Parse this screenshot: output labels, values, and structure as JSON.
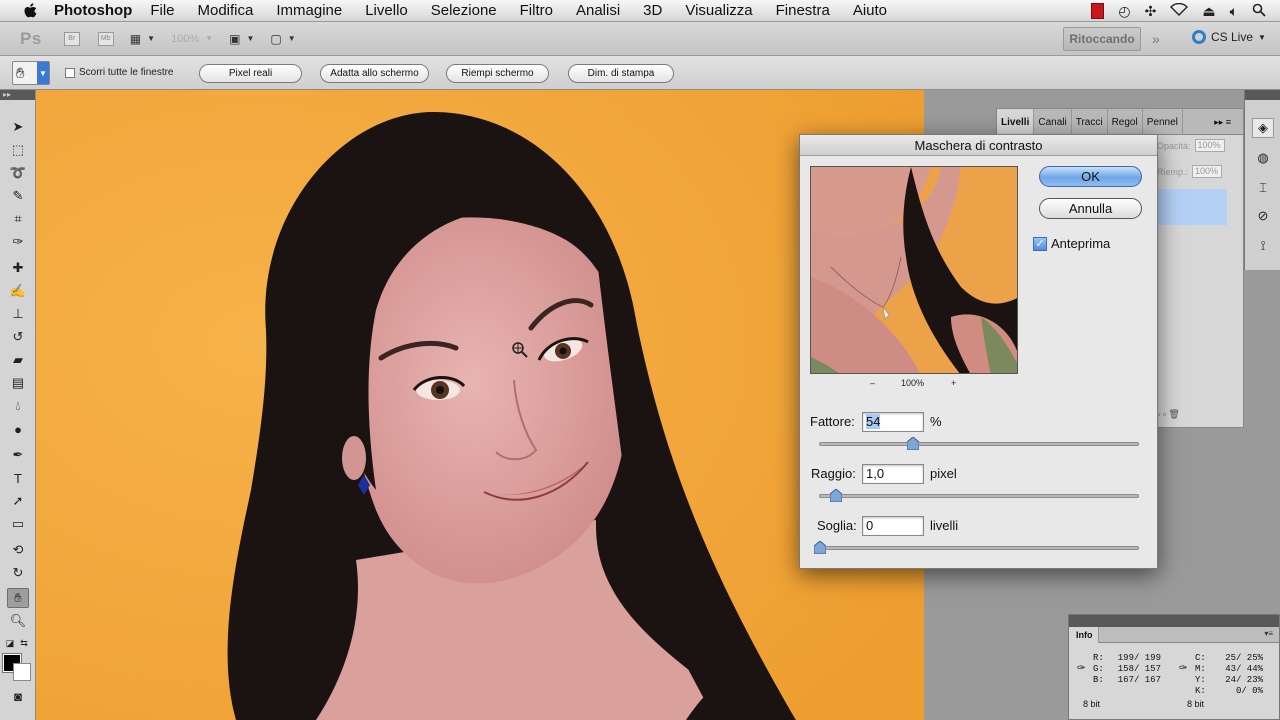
{
  "menubar": {
    "app_name": "Photoshop",
    "items": [
      "File",
      "Modifica",
      "Immagine",
      "Livello",
      "Selezione",
      "Filtro",
      "Analisi",
      "3D",
      "Visualizza",
      "Finestra",
      "Aiuto"
    ]
  },
  "appbar": {
    "logo": "Ps",
    "br_label": "Br",
    "mb_label": "Mb",
    "zoom": "100%",
    "workspace": "Ritoccando",
    "cs_live": "CS Live"
  },
  "options": {
    "scroll_all_label": "Scorri tutte le finestre",
    "buttons": [
      "Pixel reali",
      "Adatta allo schermo",
      "Riempi schermo",
      "Dim. di stampa"
    ]
  },
  "layers_panel": {
    "tabs": [
      "Livelli",
      "Canali",
      "Tracci",
      "Regol",
      "Pennel"
    ],
    "opacity_label": "Opacità:",
    "opacity_value": "100%",
    "fill_label": "Riemp.:",
    "fill_value": "100%"
  },
  "dialog": {
    "title": "Maschera di contrasto",
    "ok": "OK",
    "cancel": "Annulla",
    "preview_label": "Anteprima",
    "preview_checked": true,
    "zoom_minus": "–",
    "zoom_value": "100%",
    "zoom_plus": "+",
    "amount": {
      "label": "Fattore:",
      "value": "54",
      "unit": "%",
      "slider_fraction": 0.294
    },
    "radius": {
      "label": "Raggio:",
      "value": "1,0",
      "unit": "pixel",
      "slider_fraction": 0.05
    },
    "threshold": {
      "label": "Soglia:",
      "value": "0",
      "unit": "livelli",
      "slider_fraction": 0.0
    }
  },
  "info_panel": {
    "tab": "Info",
    "rgb": [
      {
        "label": "R:",
        "value": "199/ 199"
      },
      {
        "label": "G:",
        "value": "158/ 157"
      },
      {
        "label": "B:",
        "value": "167/ 167"
      }
    ],
    "cmyk": [
      {
        "label": "C:",
        "value": "25/ 25%"
      },
      {
        "label": "M:",
        "value": "43/ 44%"
      },
      {
        "label": "Y:",
        "value": "24/ 23%"
      },
      {
        "label": "K:",
        "value": "0/ 0%"
      }
    ],
    "bits_left": "8 bit",
    "bits_right": "8 bit"
  },
  "colors": {
    "canvas_background": "#f3a93f",
    "accent_blue": "#3b79d8",
    "panel_gray": "#d4d4d4"
  }
}
